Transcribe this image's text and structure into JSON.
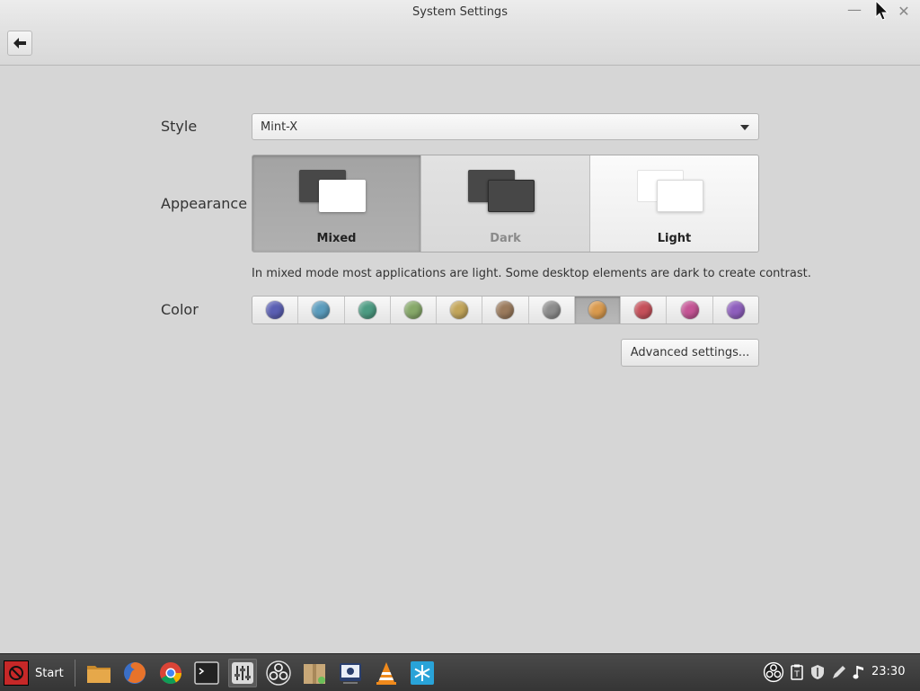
{
  "window": {
    "title": "System Settings"
  },
  "settings": {
    "style_label": "Style",
    "style_value": "Mint-X",
    "appearance_label": "Appearance",
    "appearance_modes": [
      {
        "label": "Mixed",
        "selected": true
      },
      {
        "label": "Dark",
        "selected": false
      },
      {
        "label": "Light",
        "selected": false
      }
    ],
    "appearance_hint": "In mixed mode most applications are light. Some desktop elements are dark to create contrast.",
    "color_label": "Color",
    "colors": [
      {
        "name": "blue",
        "hex": "#5a5fb3"
      },
      {
        "name": "aqua",
        "hex": "#5b9cbd"
      },
      {
        "name": "teal",
        "hex": "#4c9b82"
      },
      {
        "name": "green",
        "hex": "#86a869"
      },
      {
        "name": "sand",
        "hex": "#c2a55a"
      },
      {
        "name": "brown",
        "hex": "#9a7a5c"
      },
      {
        "name": "grey",
        "hex": "#8c8c8c"
      },
      {
        "name": "orange",
        "hex": "#d99a4e",
        "selected": true
      },
      {
        "name": "red",
        "hex": "#c5505a"
      },
      {
        "name": "pink",
        "hex": "#c45595"
      },
      {
        "name": "purple",
        "hex": "#8e5fbd"
      }
    ],
    "advanced_button": "Advanced settings..."
  },
  "taskbar": {
    "start_label": "Start",
    "apps": [
      "files-icon",
      "firefox-icon",
      "chrome-icon",
      "terminal-icon",
      "system-settings-icon",
      "obs-icon",
      "archive-manager-icon",
      "media-player-icon",
      "vlc-icon",
      "snowflake-icon"
    ],
    "tray": [
      "obs-tray-icon",
      "clipboard-icon",
      "shield-icon",
      "pen-icon",
      "music-icon"
    ],
    "clock": "23:30"
  }
}
